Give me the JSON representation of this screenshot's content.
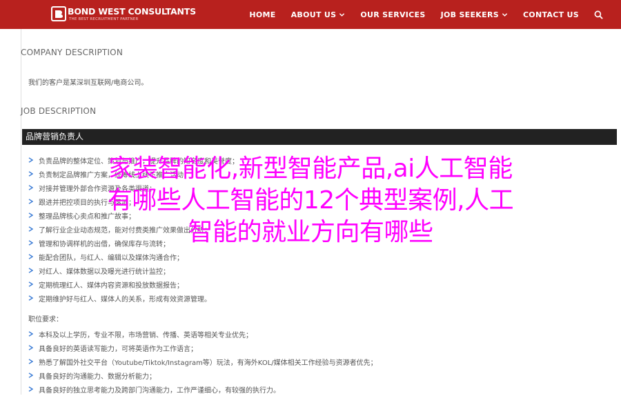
{
  "brand": {
    "name": "BOND WEST CONSULTANTS",
    "tagline": "THE BEST RECRUITMENT PARTNER"
  },
  "nav": {
    "items": [
      {
        "label": "HOME",
        "has_dropdown": false
      },
      {
        "label": "ABOUT US",
        "has_dropdown": true
      },
      {
        "label": "OUR SERVICES",
        "has_dropdown": false
      },
      {
        "label": "JOB SEEKERS",
        "has_dropdown": true
      },
      {
        "label": "CONTACT US",
        "has_dropdown": false
      }
    ],
    "search_icon": "search-icon"
  },
  "company": {
    "heading": "COMPANY DESCRIPTION",
    "text": "我们的客户是某深圳互联网/电商公司。"
  },
  "job": {
    "heading": "JOB DESCRIPTION",
    "title": "品牌营销负责人",
    "duties": [
      "负责品牌的整体定位、策划与推广，提升品牌的知名度和美誉度；",
      "负责制定品牌推广方案，统筹线上线下推广活动；",
      "对接并管理外部合作资源及各类渠道；",
      "跟进并把控项目的执行与落地；",
      "整理品牌核心卖点和推广故事；"
    ],
    "duties2": [
      "了解行业企业动态规范，能对付费类推广效果做出分析；",
      "管理和协调样机的出借，确保库存与流转；",
      "能配合团队，与红人、编辑以及媒体沟通合作；",
      "对红人、媒体数据以及曝光进行统计监控；",
      "定期梳理红人、媒体内容资源和投放数据报告；",
      "定期维护好与红人、媒体人的关系，形成有效资源管理。"
    ],
    "requirements_heading": "职位要求：",
    "requirements": [
      "本科及以上学历，专业不限，市场营销、传播、英语等相关专业优先；",
      "具备良好的英语读写能力，可将英语作为工作语言；",
      "熟悉了解国外社交平台（Youtube/Tiktok/Instagram等）玩法，有海外KOL/媒体相关工作经验与资源者优先；",
      "具备良好的沟通能力、数据分析能力；",
      "具备良好的独立思考能力及跨部门沟通能力，工作严谨细心，有较强的执行力。"
    ]
  },
  "overlay": {
    "text": "家装智能化,新型智能产品,ai人工智能\n有哪些人工智能的12个典型案例,人工\n智能的就业方向有哪些",
    "color": "#ff00ff"
  },
  "colors": {
    "nav_bg": "#b8211e",
    "title_bar_bg": "#222222",
    "bullet": "#3a7bd5",
    "overlay": "#ff00ff"
  }
}
